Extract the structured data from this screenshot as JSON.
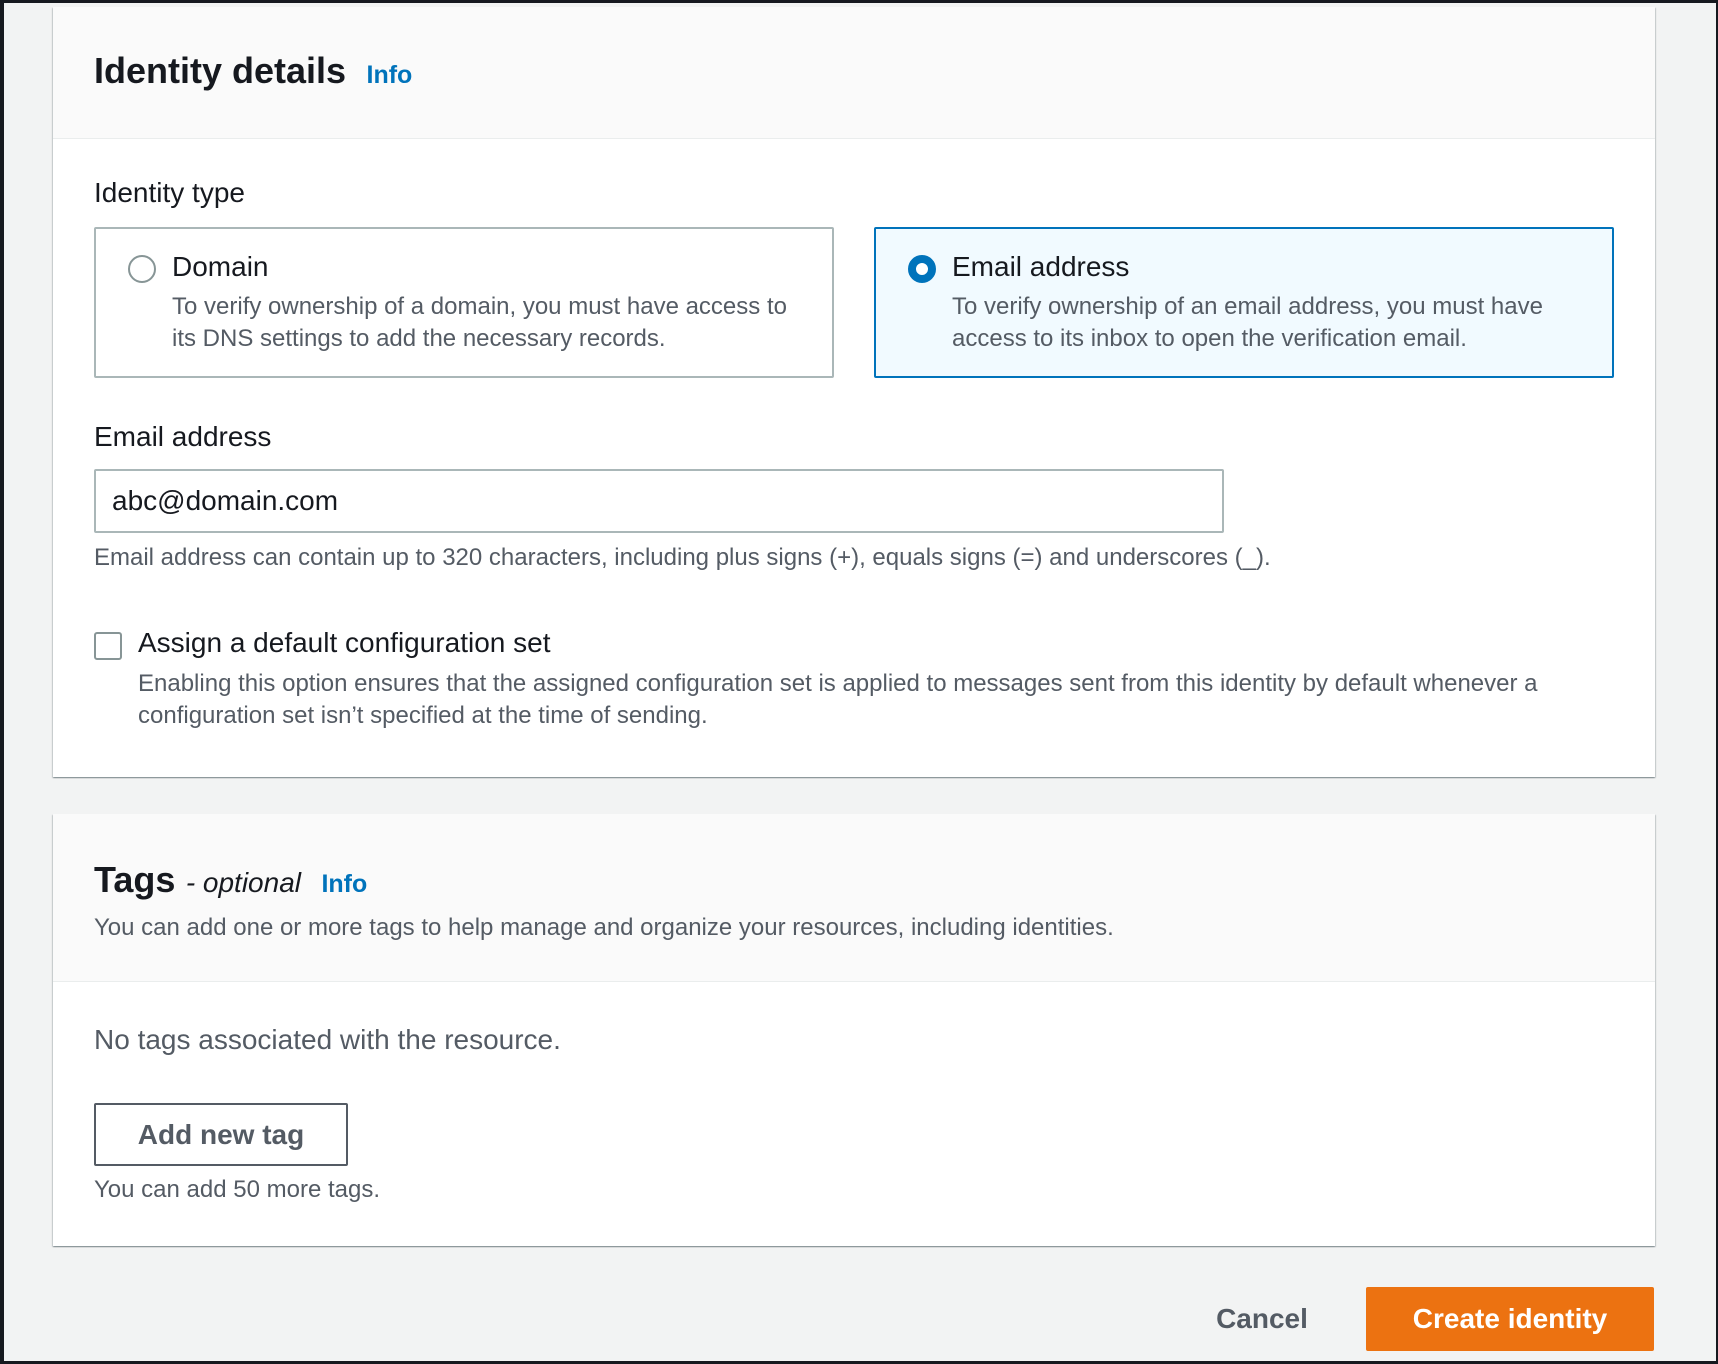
{
  "identity_details": {
    "title": "Identity details",
    "info_label": "Info",
    "identity_type_label": "Identity type",
    "options": [
      {
        "title": "Domain",
        "description": "To verify ownership of a domain, you must have access to its DNS settings to add the necessary records.",
        "selected": false
      },
      {
        "title": "Email address",
        "description": "To verify ownership of an email address, you must have access to its inbox to open the verification email.",
        "selected": true
      }
    ],
    "email_label": "Email address",
    "email_value": "abc@domain.com",
    "email_hint": "Email address can contain up to 320 characters, including plus signs (+), equals signs (=) and underscores (_).",
    "config_set_label": "Assign a default configuration set",
    "config_set_checked": false,
    "config_set_description": "Enabling this option ensures that the assigned configuration set is applied to messages sent from this identity by default whenever a configuration set isn’t specified at the time of sending."
  },
  "tags": {
    "title": "Tags",
    "optional_label": "- optional",
    "info_label": "Info",
    "description": "You can add one or more tags to help manage and organize your resources, including identities.",
    "empty_text": "No tags associated with the resource.",
    "add_button_label": "Add new tag",
    "limit_text": "You can add 50 more tags."
  },
  "footer": {
    "cancel_label": "Cancel",
    "create_label": "Create identity"
  },
  "colors": {
    "primary": "#ec7211",
    "link": "#0073bb",
    "selected_border": "#0073bb",
    "selected_bg": "#f1faff"
  }
}
